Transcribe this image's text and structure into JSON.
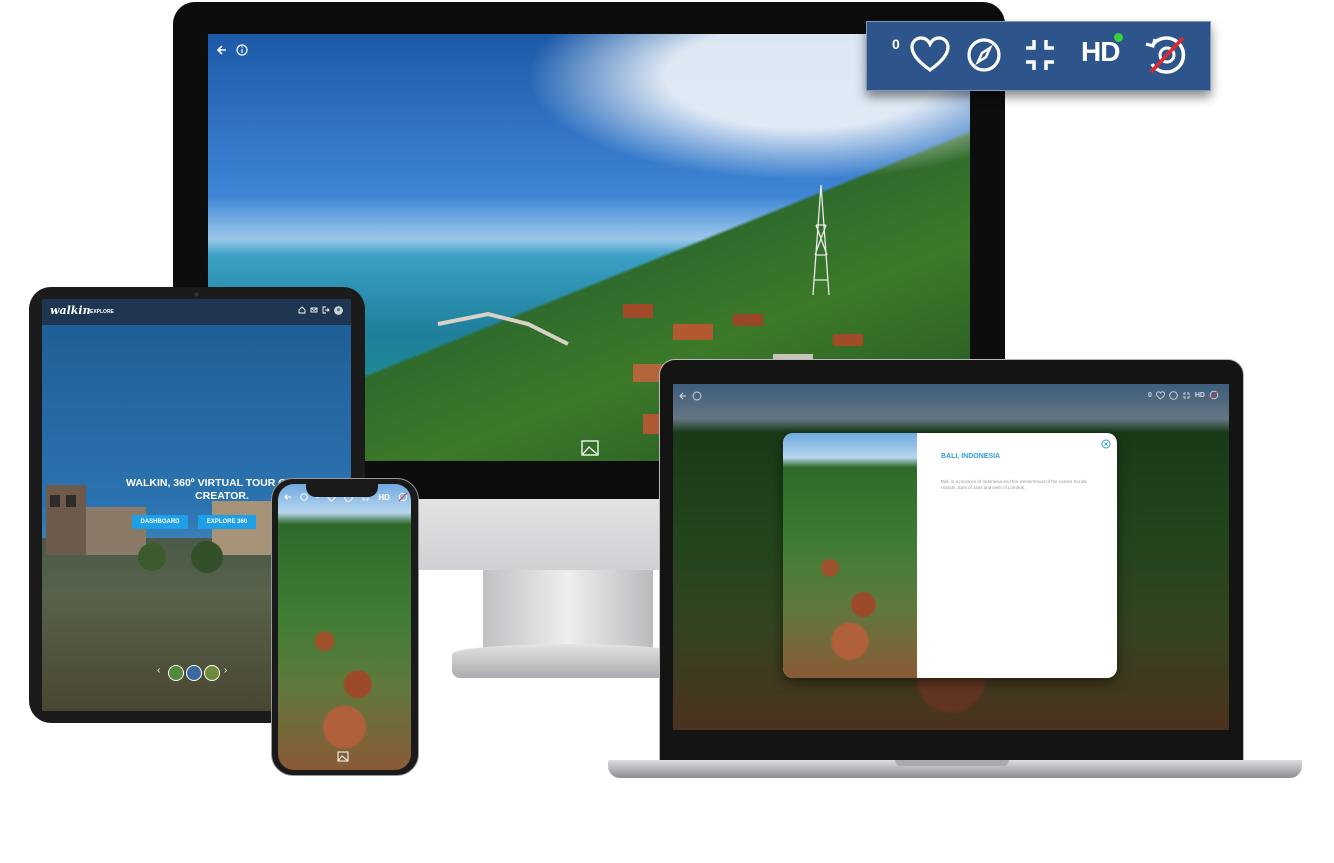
{
  "monitor": {
    "toolbar": {
      "back_icon": "arrow-left-icon",
      "info_icon": "info-icon"
    }
  },
  "zoom_toolbar": {
    "like_count": "0",
    "hd_label": "HD",
    "icons": [
      "heart-icon",
      "compass-icon",
      "compress-icon",
      "hd-icon",
      "gyro-off-icon"
    ],
    "hd_active_color": "#3ad13a",
    "background_color": "#2d558c"
  },
  "tablet": {
    "logo": "walkin",
    "nav_label": "EXPLORE",
    "heading": "WALKIN, 360º VIRTUAL TOUR ONLINE CREATOR.",
    "buttons": {
      "dashboard": "DASHBOARD",
      "explore": "EXPLORE 360"
    },
    "nav_icons": [
      "home-icon",
      "mail-icon",
      "logout-icon",
      "avatar"
    ]
  },
  "laptop": {
    "topbar": {
      "like_count": "0",
      "hd_label": "HD"
    },
    "modal": {
      "title": "BALI, INDONESIA",
      "description": "Bali, is a province of Indonesia and the westernmost of the Lesser Sunda Islands. East of Java and west of Lombok."
    }
  },
  "phone": {
    "like_count": "0",
    "hd_label": "HD"
  },
  "colors": {
    "accent": "#1ea0e8",
    "nav": "#1f3652"
  }
}
